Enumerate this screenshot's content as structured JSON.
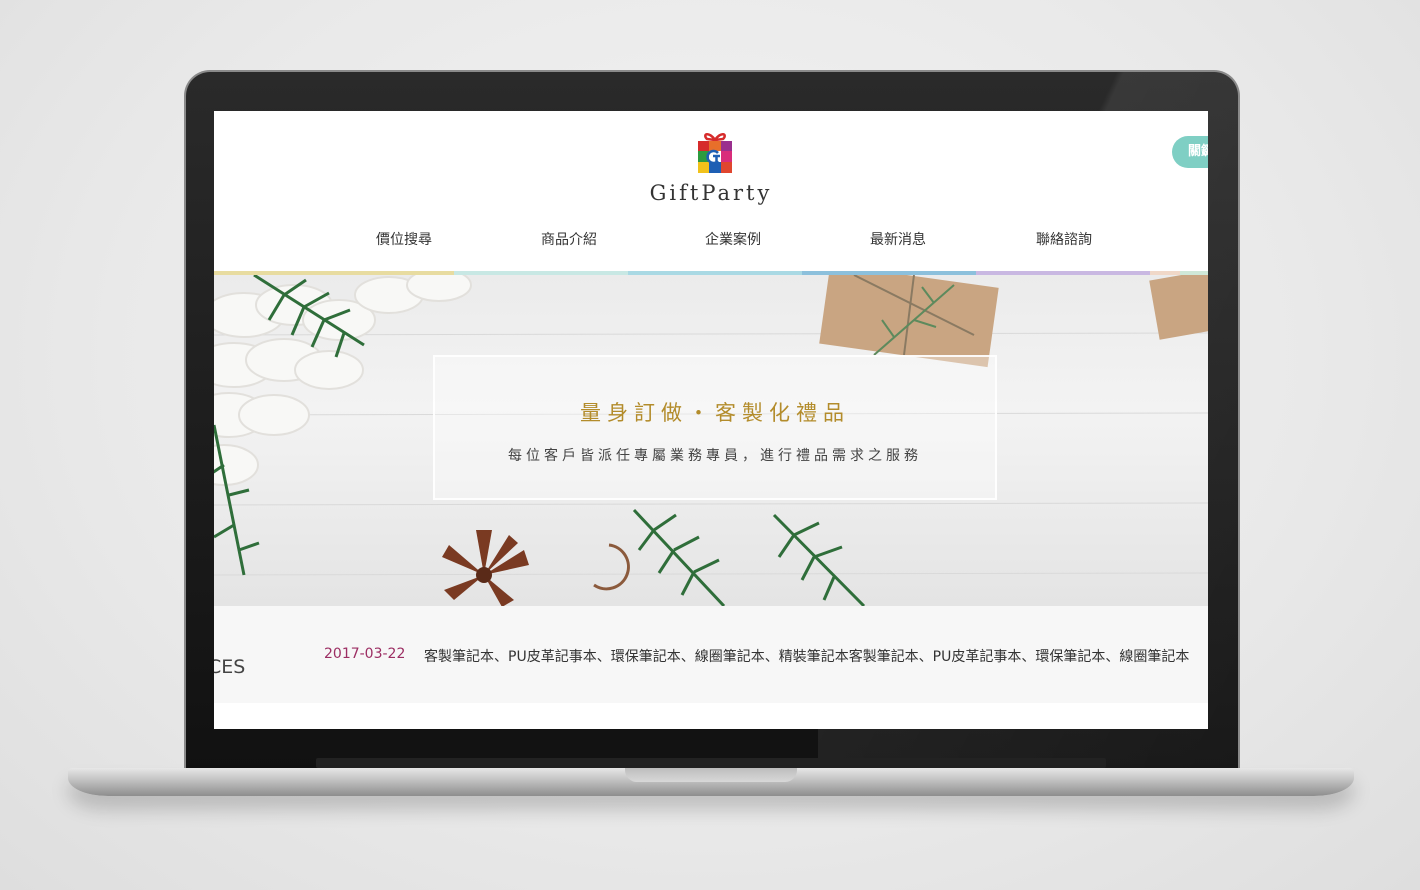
{
  "brand": {
    "name": "GiftParty"
  },
  "header": {
    "pill_label": "關鍵"
  },
  "nav": {
    "items": [
      {
        "label": "價位搜尋"
      },
      {
        "label": "商品介紹"
      },
      {
        "label": "企業案例"
      },
      {
        "label": "最新消息"
      },
      {
        "label": "聯絡諮詢"
      }
    ],
    "bar_colors": [
      "#e8dca0",
      "#c8e8e4",
      "#a9d9e4",
      "#8cc0dc",
      "#c9b8e2",
      "#f0d8c8",
      "#cfe8d8"
    ]
  },
  "hero": {
    "title": "量身訂做・客製化禮品",
    "subtitle": "每位客戶皆派任專屬業務專員，進行禮品需求之服務"
  },
  "news": {
    "section_fragment": "CES",
    "date": "2017-03-22",
    "text": "客製筆記本、PU皮革記事本、環保筆記本、線圈筆記本、精裝筆記本客製筆記本、PU皮革記事本、環保筆記本、線圈筆記本"
  },
  "colors": {
    "accent_gold": "#b38c2b",
    "date_color": "#9c2e63",
    "pill_color": "#7fcfc4"
  },
  "icons": {
    "logo": "gift-box-logo-icon"
  }
}
